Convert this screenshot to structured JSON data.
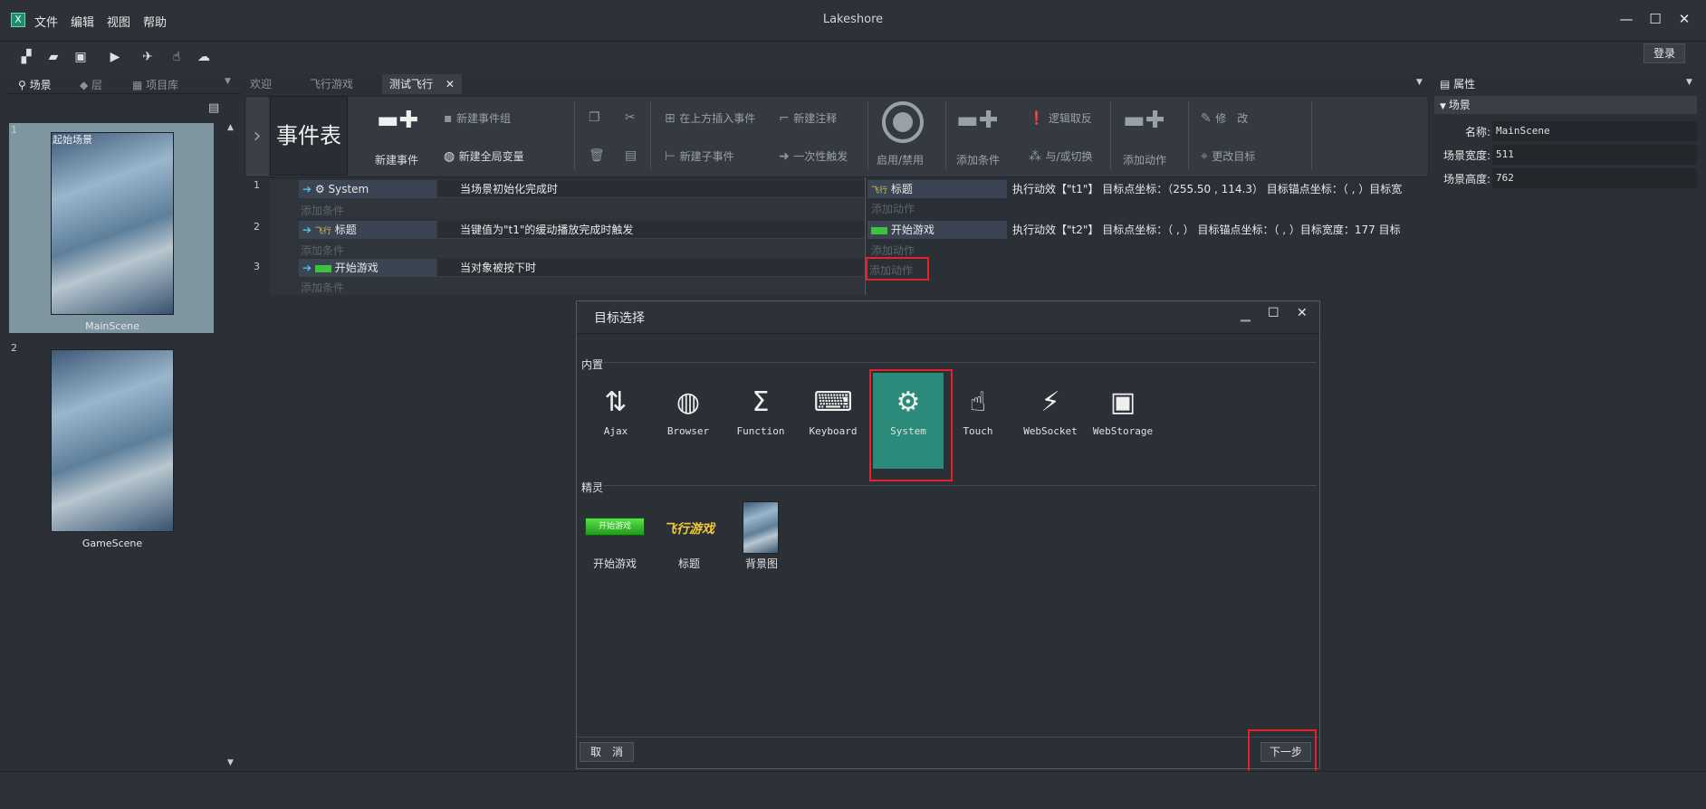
{
  "app": {
    "title": "Lakeshore",
    "logo": "X",
    "login": "登录"
  },
  "menu": [
    "文件",
    "编辑",
    "视图",
    "帮助"
  ],
  "window_controls": {
    "minimize": "—",
    "maximize": "☐",
    "close": "✕"
  },
  "toolbar_icons": [
    "new-file-icon",
    "open-folder-icon",
    "save-icon",
    "play-icon",
    "rocket-icon",
    "share-icon",
    "cloud-upload-icon"
  ],
  "left_panel": {
    "tabs": [
      "场景",
      "层",
      "项目库"
    ],
    "dropdown": "▼",
    "scenes": [
      {
        "index": "1",
        "label": "起始场景",
        "name": "MainScene"
      },
      {
        "index": "2",
        "label": "",
        "name": "GameScene"
      }
    ]
  },
  "doc_tabs": [
    "欢迎",
    "飞行游戏",
    "测试飞行"
  ],
  "ribbon": {
    "event_table": "事件表",
    "new_event": "新建事件",
    "new_event_group": "新建事件组",
    "new_global_var": "新建全局变量",
    "insert_above": "在上方插入事件",
    "new_comment": "新建注释",
    "new_sub_event": "新建子事件",
    "once_trigger": "一次性触发",
    "enable_disable": "启用/禁用",
    "add_condition": "添加条件",
    "logic_invert": "逻辑取反",
    "and_or": "与/或切换",
    "add_action": "添加动作",
    "modify": "修　改",
    "change_target": "更改目标"
  },
  "events": [
    {
      "num": "1",
      "object": "System",
      "condition": "当场景初始化完成时",
      "add_condition": "添加条件",
      "action_object": "标题",
      "action_text": "执行动效【\"t1\"】 目标点坐标：（255.50 , 114.3） 目标锚点坐标：（ , ）目标宽",
      "add_action": "添加动作"
    },
    {
      "num": "2",
      "object": "标题",
      "condition": "当键值为\"t1\"的缓动播放完成时触发",
      "add_condition": "添加条件",
      "action_object": "开始游戏",
      "action_text": "执行动效【\"t2\"】 目标点坐标：（ , ） 目标锚点坐标：（ , ）目标宽度：177 目标",
      "add_action": "添加动作"
    },
    {
      "num": "3",
      "object": "开始游戏",
      "condition": "当对象被按下时",
      "add_condition": "添加条件",
      "action_object": "",
      "action_text": "",
      "add_action": "添加动作"
    }
  ],
  "dialog": {
    "title": "目标选择",
    "section_builtin": "内置",
    "builtin": [
      {
        "name": "Ajax",
        "icon": "ajax-icon",
        "glyph": "⇅"
      },
      {
        "name": "Browser",
        "icon": "globe-icon",
        "glyph": "◍"
      },
      {
        "name": "Function",
        "icon": "sigma-icon",
        "glyph": "Σ"
      },
      {
        "name": "Keyboard",
        "icon": "keyboard-icon",
        "glyph": "⌨"
      },
      {
        "name": "System",
        "icon": "gears-icon",
        "glyph": "⚙"
      },
      {
        "name": "Touch",
        "icon": "touch-icon",
        "glyph": "☝"
      },
      {
        "name": "WebSocket",
        "icon": "plug-icon",
        "glyph": "⚡"
      },
      {
        "name": "WebStorage",
        "icon": "floppy-icon",
        "glyph": "▣"
      }
    ],
    "section_sprites": "精灵",
    "sprites": [
      {
        "name": "开始游戏",
        "thumb_text": "开始游戏"
      },
      {
        "name": "标题",
        "thumb_text": "飞行游戏"
      },
      {
        "name": "背景图",
        "thumb_text": ""
      }
    ],
    "cancel": "取　消",
    "next": "下一步"
  },
  "properties": {
    "tab": "属性",
    "section": "场景",
    "rows": [
      {
        "label": "名称:",
        "value": "MainScene"
      },
      {
        "label": "场景宽度:",
        "value": "511"
      },
      {
        "label": "场景高度:",
        "value": "762"
      }
    ]
  },
  "colors": {
    "accent": "#2b8a7a",
    "highlight": "#e5222a",
    "bg": "#2b2f36"
  }
}
